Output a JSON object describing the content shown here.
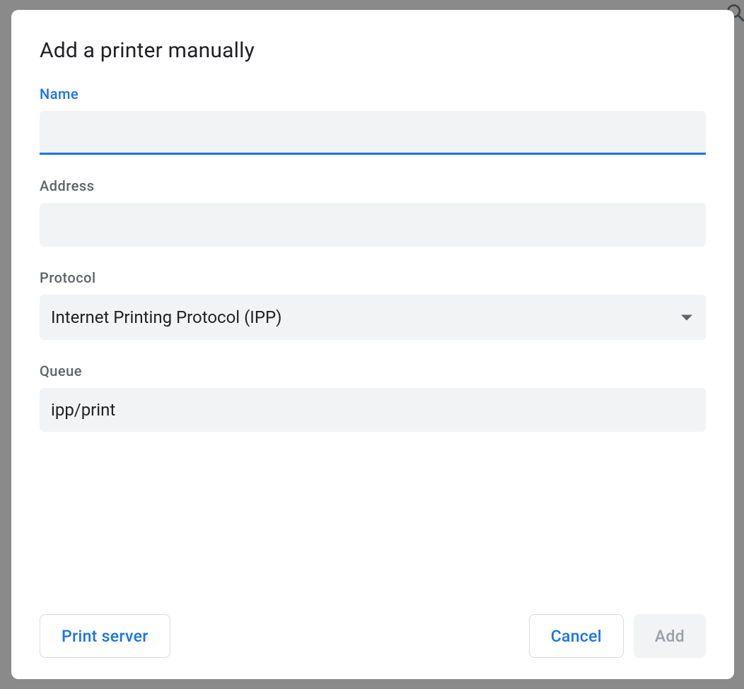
{
  "dialog": {
    "title": "Add a printer manually",
    "fields": {
      "name": {
        "label": "Name",
        "value": ""
      },
      "address": {
        "label": "Address",
        "value": ""
      },
      "protocol": {
        "label": "Protocol",
        "selected": "Internet Printing Protocol (IPP)"
      },
      "queue": {
        "label": "Queue",
        "value": "ipp/print"
      }
    },
    "buttons": {
      "print_server": "Print server",
      "cancel": "Cancel",
      "add": "Add"
    }
  }
}
